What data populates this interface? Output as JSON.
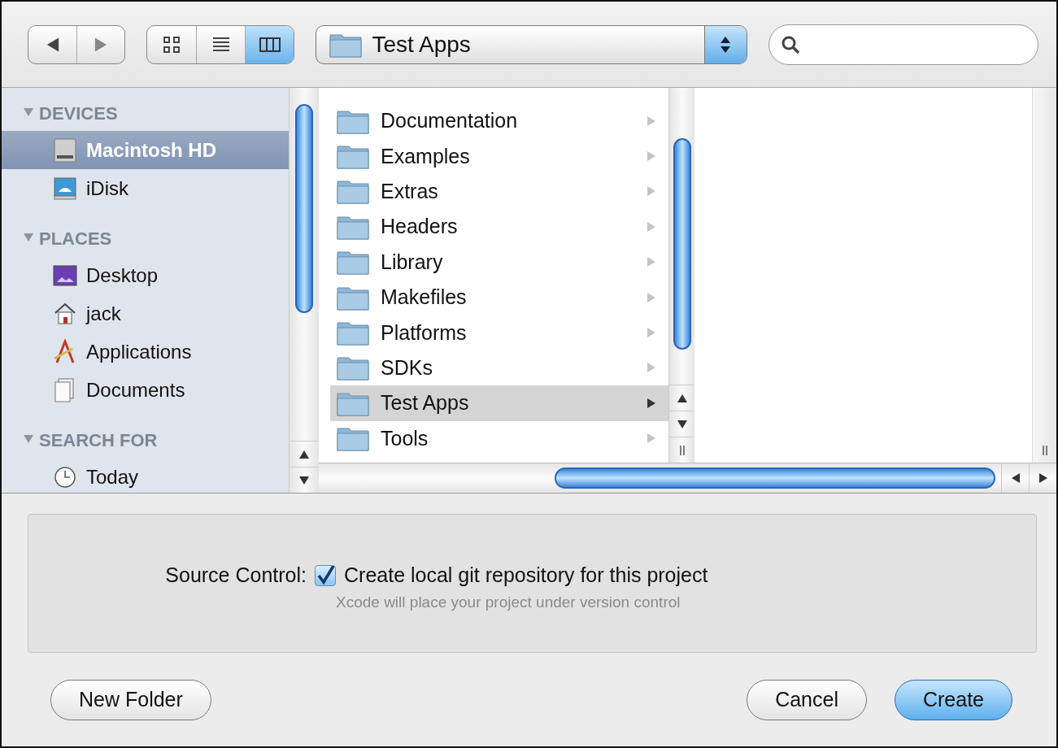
{
  "toolbar": {
    "nav_buttons": [
      {
        "kind": "back"
      },
      {
        "kind": "forward"
      }
    ],
    "view_buttons": [
      {
        "kind": "icons",
        "selected": false
      },
      {
        "kind": "list",
        "selected": false
      },
      {
        "kind": "columns",
        "selected": true
      }
    ],
    "location": {
      "label": "Test Apps"
    }
  },
  "sidebar": {
    "sections": [
      {
        "title": "DEVICES",
        "expanded": true,
        "items": [
          {
            "label": "Macintosh HD",
            "kind": "drive",
            "selected": true
          },
          {
            "label": "iDisk",
            "kind": "idisk",
            "selected": false
          }
        ]
      },
      {
        "title": "PLACES",
        "expanded": true,
        "items": [
          {
            "label": "Desktop",
            "kind": "desktop",
            "selected": false
          },
          {
            "label": "jack",
            "kind": "home",
            "selected": false
          },
          {
            "label": "Applications",
            "kind": "apps",
            "selected": false
          },
          {
            "label": "Documents",
            "kind": "docs",
            "selected": false
          }
        ]
      },
      {
        "title": "SEARCH FOR",
        "expanded": true,
        "items": [
          {
            "label": "Today",
            "kind": "clock",
            "selected": false
          }
        ]
      }
    ]
  },
  "column": {
    "items": [
      {
        "label": "Documentation",
        "selected": false
      },
      {
        "label": "Examples",
        "selected": false
      },
      {
        "label": "Extras",
        "selected": false
      },
      {
        "label": "Headers",
        "selected": false
      },
      {
        "label": "Library",
        "selected": false
      },
      {
        "label": "Makefiles",
        "selected": false
      },
      {
        "label": "Platforms",
        "selected": false
      },
      {
        "label": "SDKs",
        "selected": false
      },
      {
        "label": "Test Apps",
        "selected": true
      },
      {
        "label": "Tools",
        "selected": false
      }
    ]
  },
  "source_control": {
    "label": "Source Control:",
    "checkbox": {
      "label": "Create local git repository for this project",
      "checked": true
    },
    "note": "Xcode will place your project under version control"
  },
  "buttons": [
    {
      "label": "New Folder",
      "kind": "left",
      "default": false
    },
    {
      "label": "Cancel",
      "kind": "right",
      "default": false
    },
    {
      "label": "Create",
      "kind": "right",
      "default": true
    }
  ]
}
